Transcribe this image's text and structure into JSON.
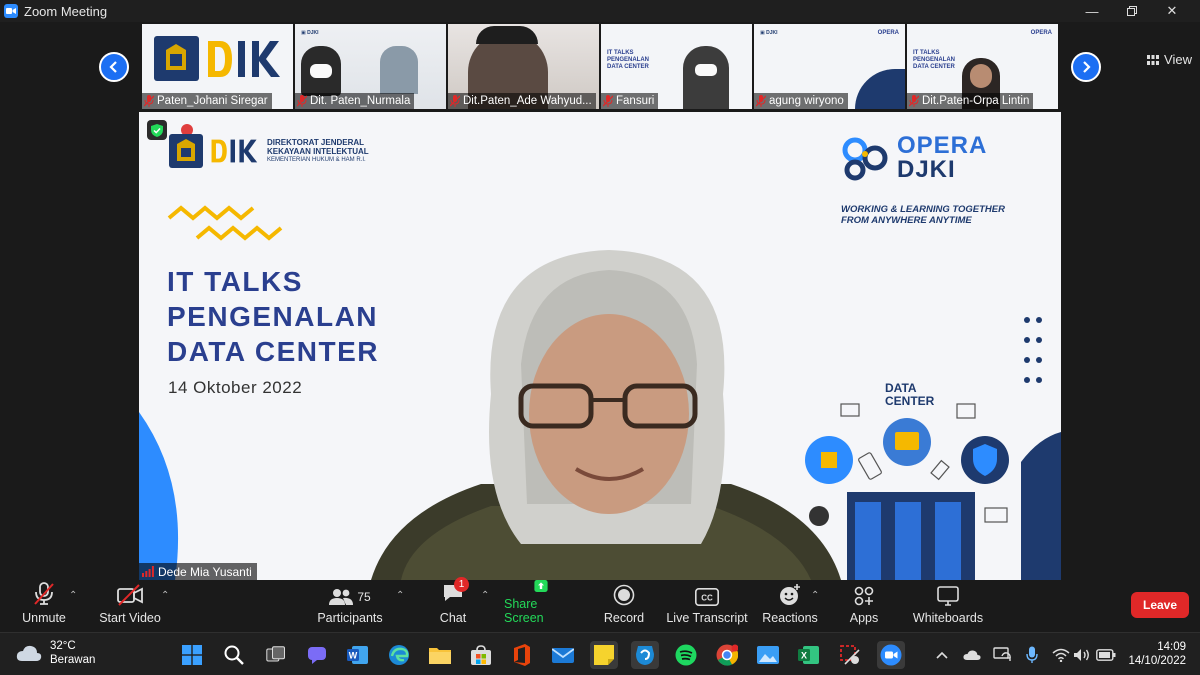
{
  "window": {
    "title": "Zoom Meeting",
    "controls": [
      "minimize-icon",
      "restore-icon",
      "close-icon"
    ]
  },
  "gallery": {
    "view_label": "View",
    "participants": [
      {
        "name": "Paten_Johani Siregar"
      },
      {
        "name": "Dit. Paten_Nurmala"
      },
      {
        "name": "Dit.Paten_Ade Wahyud..."
      },
      {
        "name": "Fansuri"
      },
      {
        "name": "agung wiryono"
      },
      {
        "name": "Dit.Paten-Orpa Lintin"
      }
    ]
  },
  "slide": {
    "org_line1": "DIREKTORAT JENDERAL",
    "org_line2": "KEKAYAAN INTELEKTUAL",
    "org_line3": "KEMENTERIAN HUKUM & HAM R.I.",
    "logo_text": "DJKI",
    "brand_line1": "OPERA",
    "brand_line2": "DJKI",
    "tagline1": "WORKING & LEARNING TOGETHER",
    "tagline2": "FROM ANYWHERE ANYTIME",
    "title1": "IT TALKS",
    "title2": "PENGENALAN",
    "title3": "DATA CENTER",
    "date": "14 Oktober 2022",
    "dc_label1": "DATA",
    "dc_label2": "CENTER"
  },
  "active_speaker": {
    "name": "Dede Mia Yusanti"
  },
  "toolbar": {
    "unmute": "Unmute",
    "start_video": "Start Video",
    "participants": "Participants",
    "participants_count": "75",
    "chat": "Chat",
    "chat_badge": "1",
    "share_screen": "Share Screen",
    "record": "Record",
    "live_transcript": "Live Transcript",
    "cc": "CC",
    "reactions": "Reactions",
    "apps": "Apps",
    "whiteboards": "Whiteboards",
    "leave": "Leave"
  },
  "taskbar": {
    "weather_temp": "32°C",
    "weather_desc": "Berawan",
    "time": "14:09",
    "date": "14/10/2022",
    "apps": [
      "windows-start-icon",
      "search-icon",
      "task-view-icon",
      "chat-icon",
      "word-icon",
      "edge-icon",
      "file-explorer-icon",
      "store-icon",
      "office-icon",
      "mail-icon",
      "sticky-notes-icon",
      "app-icon",
      "spotify-icon",
      "chrome-icon",
      "photos-icon",
      "excel-icon",
      "snipping-tool-icon",
      "zoom-icon"
    ],
    "tray": [
      "chevron-up-icon",
      "cloud-icon",
      "sync-icon",
      "mic-icon",
      "wifi-icon",
      "volume-icon",
      "battery-icon"
    ]
  },
  "colors": {
    "accent": "#2d8cff",
    "leave": "#e02828",
    "share": "#23d959",
    "slide_title": "#2a3f8f",
    "gold": "#f5b800"
  }
}
